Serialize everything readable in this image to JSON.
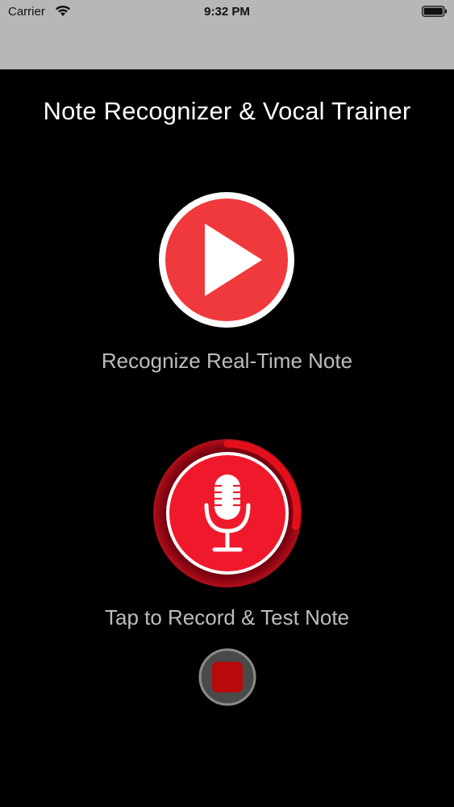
{
  "status_bar": {
    "carrier": "Carrier",
    "time": "9:32 PM",
    "wifi_icon": "wifi-icon",
    "battery_icon": "battery-icon"
  },
  "app": {
    "title": "Note Recognizer & Vocal Trainer"
  },
  "controls": {
    "play": {
      "label": "Recognize Real-Time Note",
      "icon": "play-icon"
    },
    "record": {
      "label": "Tap to Record & Test Note",
      "icon": "microphone-icon",
      "progress": 0.28
    },
    "stop": {
      "icon": "stop-icon"
    }
  },
  "colors": {
    "play_red": "#f0393d",
    "record_red": "#f0192c",
    "record_ring": "#e3101c",
    "stop_square": "#b80a0a",
    "stop_bg": "#4a4a4a",
    "label_gray": "#bdbdbd"
  }
}
